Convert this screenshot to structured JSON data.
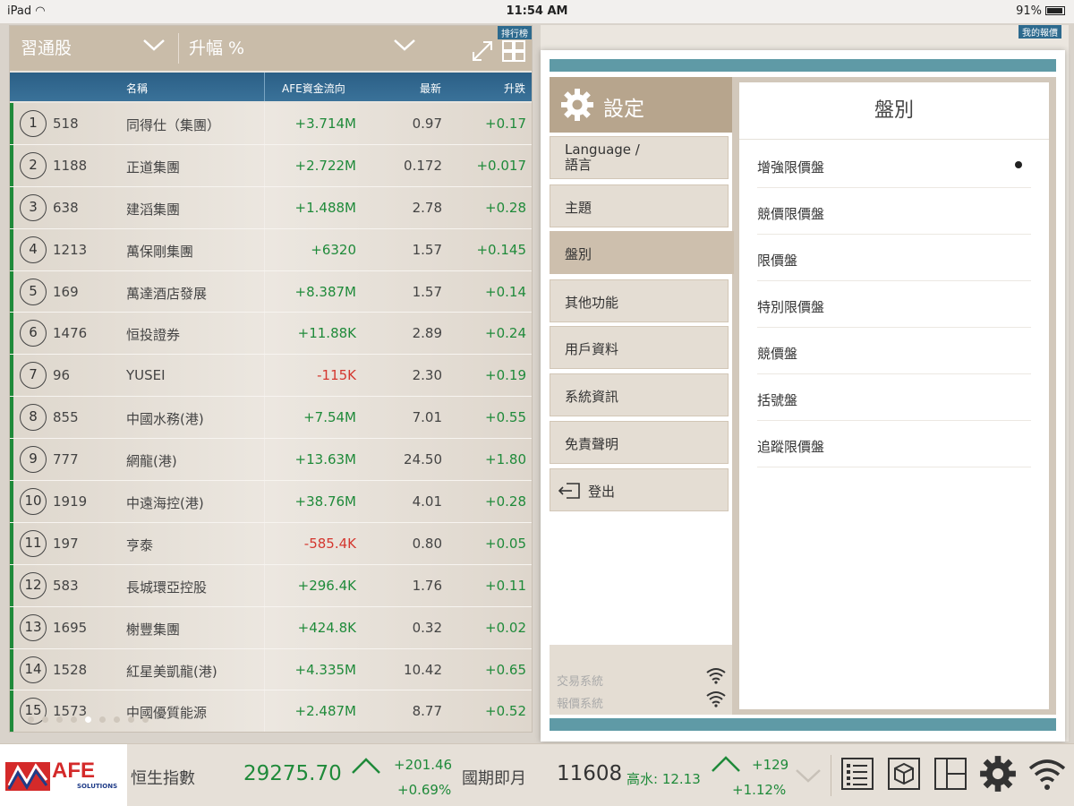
{
  "statusbar": {
    "device": "iPad",
    "time": "11:54 AM",
    "battery": "91%"
  },
  "left_panel": {
    "dropdown1": "習通股",
    "dropdown2": "升幅 %",
    "tag": "排行榜",
    "columns": {
      "name": "名稱",
      "flow": "AFE資金流向",
      "price": "最新",
      "change": "升跌"
    },
    "rows": [
      {
        "rank": "1",
        "code": "518",
        "name": "同得仕（集團）",
        "flow": "+3.714M",
        "price": "0.97",
        "change": "+0.17"
      },
      {
        "rank": "2",
        "code": "1188",
        "name": "正道集團",
        "flow": "+2.722M",
        "price": "0.172",
        "change": "+0.017"
      },
      {
        "rank": "3",
        "code": "638",
        "name": "建滔集團",
        "flow": "+1.488M",
        "price": "2.78",
        "change": "+0.28"
      },
      {
        "rank": "4",
        "code": "1213",
        "name": "萬保剛集團",
        "flow": "+6320",
        "price": "1.57",
        "change": "+0.145"
      },
      {
        "rank": "5",
        "code": "169",
        "name": "萬達酒店發展",
        "flow": "+8.387M",
        "price": "1.57",
        "change": "+0.14"
      },
      {
        "rank": "6",
        "code": "1476",
        "name": "恒投證券",
        "flow": "+11.88K",
        "price": "2.89",
        "change": "+0.24"
      },
      {
        "rank": "7",
        "code": "96",
        "name": "YUSEI",
        "flow": "-115K",
        "price": "2.30",
        "change": "+0.19"
      },
      {
        "rank": "8",
        "code": "855",
        "name": "中國水務(港)",
        "flow": "+7.54M",
        "price": "7.01",
        "change": "+0.55"
      },
      {
        "rank": "9",
        "code": "777",
        "name": "網龍(港)",
        "flow": "+13.63M",
        "price": "24.50",
        "change": "+1.80"
      },
      {
        "rank": "10",
        "code": "1919",
        "name": "中遠海控(港)",
        "flow": "+38.76M",
        "price": "4.01",
        "change": "+0.28"
      },
      {
        "rank": "11",
        "code": "197",
        "name": "亨泰",
        "flow": "-585.4K",
        "price": "0.80",
        "change": "+0.05"
      },
      {
        "rank": "12",
        "code": "583",
        "name": "長城環亞控股",
        "flow": "+296.4K",
        "price": "1.76",
        "change": "+0.11"
      },
      {
        "rank": "13",
        "code": "1695",
        "name": "榭豐集團",
        "flow": "+424.8K",
        "price": "0.32",
        "change": "+0.02"
      },
      {
        "rank": "14",
        "code": "1528",
        "name": "紅星美凱龍(港)",
        "flow": "+4.335M",
        "price": "10.42",
        "change": "+0.65"
      },
      {
        "rank": "15",
        "code": "1573",
        "name": "中國優質能源",
        "flow": "+2.487M",
        "price": "8.77",
        "change": "+0.52"
      }
    ]
  },
  "right_bg": {
    "tag": "我的報價"
  },
  "settings": {
    "title": "設定",
    "menu": [
      {
        "label": "Language /\n語言"
      },
      {
        "label": "主題"
      },
      {
        "label": "盤別"
      },
      {
        "label": "其他功能"
      },
      {
        "label": "用戶資料"
      },
      {
        "label": "系統資訊"
      },
      {
        "label": "免責聲明"
      },
      {
        "label": "登出"
      }
    ],
    "status": {
      "trade": "交易系統",
      "quote": "報價系統"
    },
    "detail": {
      "title": "盤別",
      "options": [
        {
          "label": "增強限價盤",
          "selected": true
        },
        {
          "label": "競價限價盤"
        },
        {
          "label": "限價盤"
        },
        {
          "label": "特別限價盤"
        },
        {
          "label": "競價盤"
        },
        {
          "label": "括號盤"
        },
        {
          "label": "追蹤限價盤"
        }
      ]
    }
  },
  "bottombar": {
    "logo": "AFE",
    "logo_sub": "SOLUTIONS",
    "index_label": "恒生指數",
    "index_value": "29275.70",
    "index_change": "+201.46",
    "index_pct": "+0.69%",
    "futures_label": "國期即月",
    "futures_value": "11608",
    "futures_premium": "高水: 12.13",
    "futures_change": "+129",
    "futures_pct": "+1.12%"
  },
  "colors": {
    "positive": "#1f8a3a",
    "negative": "#d4372f",
    "header_blue": "#2b5f86",
    "accent_teal": "#5f9aa6"
  }
}
